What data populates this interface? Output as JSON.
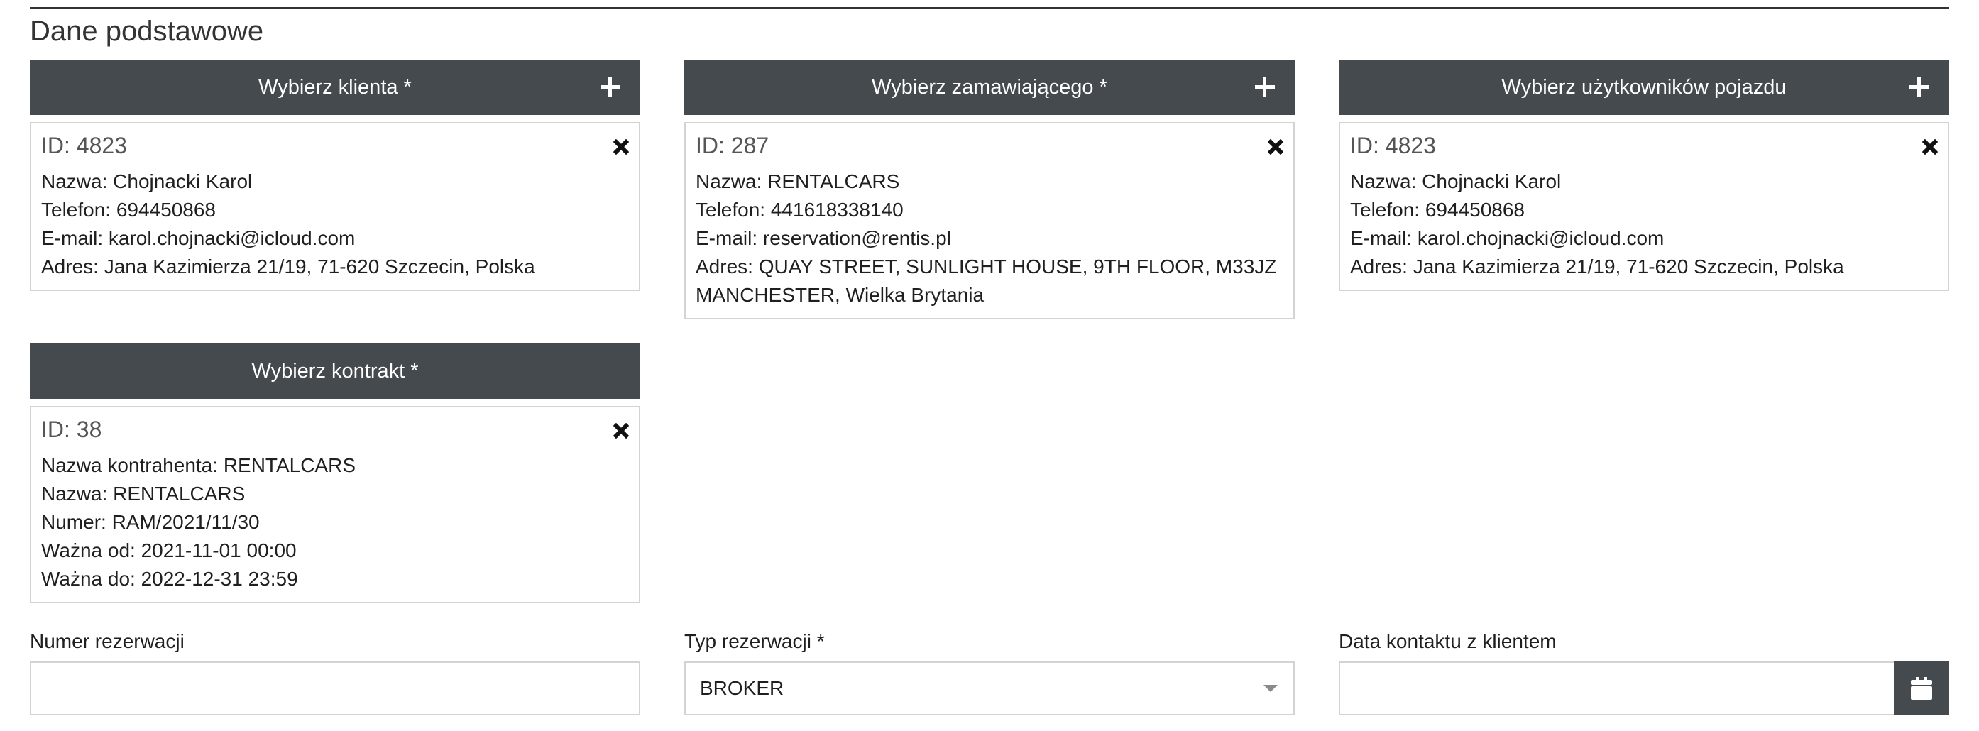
{
  "section": {
    "title": "Dane podstawowe"
  },
  "client": {
    "button_label": "Wybierz klienta *",
    "id_text": "ID: 4823",
    "name": "Nazwa: Chojnacki Karol",
    "phone": "Telefon: 694450868",
    "email": "E-mail: karol.chojnacki@icloud.com",
    "address": "Adres: Jana Kazimierza 21/19, 71-620 Szczecin, Polska"
  },
  "orderer": {
    "button_label": "Wybierz zamawiającego *",
    "id_text": "ID: 287",
    "name": "Nazwa: RENTALCARS",
    "phone": "Telefon: 441618338140",
    "email": "E-mail: reservation@rentis.pl",
    "address": "Adres: QUAY STREET, SUNLIGHT HOUSE, 9TH FLOOR, M33JZ MANCHESTER, Wielka Brytania"
  },
  "vehicle_users": {
    "button_label": "Wybierz użytkowników pojazdu",
    "id_text": "ID: 4823",
    "name": "Nazwa: Chojnacki Karol",
    "phone": "Telefon: 694450868",
    "email": "E-mail: karol.chojnacki@icloud.com",
    "address": "Adres: Jana Kazimierza 21/19, 71-620 Szczecin, Polska"
  },
  "contract": {
    "button_label": "Wybierz kontrakt *",
    "id_text": "ID: 38",
    "contractor_name": "Nazwa kontrahenta: RENTALCARS",
    "name": "Nazwa: RENTALCARS",
    "number": "Numer: RAM/2021/11/30",
    "valid_from": "Ważna od: 2021-11-01 00:00",
    "valid_to": "Ważna do: 2022-12-31 23:59"
  },
  "fields": {
    "reservation_number": {
      "label": "Numer rezerwacji",
      "value": "",
      "placeholder": ""
    },
    "reservation_type": {
      "label": "Typ rezerwacji *",
      "selected": "BROKER"
    },
    "client_contact_date": {
      "label": "Data kontaktu z klientem",
      "value": "",
      "placeholder": ""
    }
  },
  "icons": {
    "add": "plus-icon",
    "remove": "close-icon",
    "dropdown": "caret-down-icon",
    "calendar": "calendar-icon"
  },
  "colors": {
    "button_bg": "#454a4f",
    "card_border": "#d3d3d3",
    "text": "#1f1f1f"
  }
}
